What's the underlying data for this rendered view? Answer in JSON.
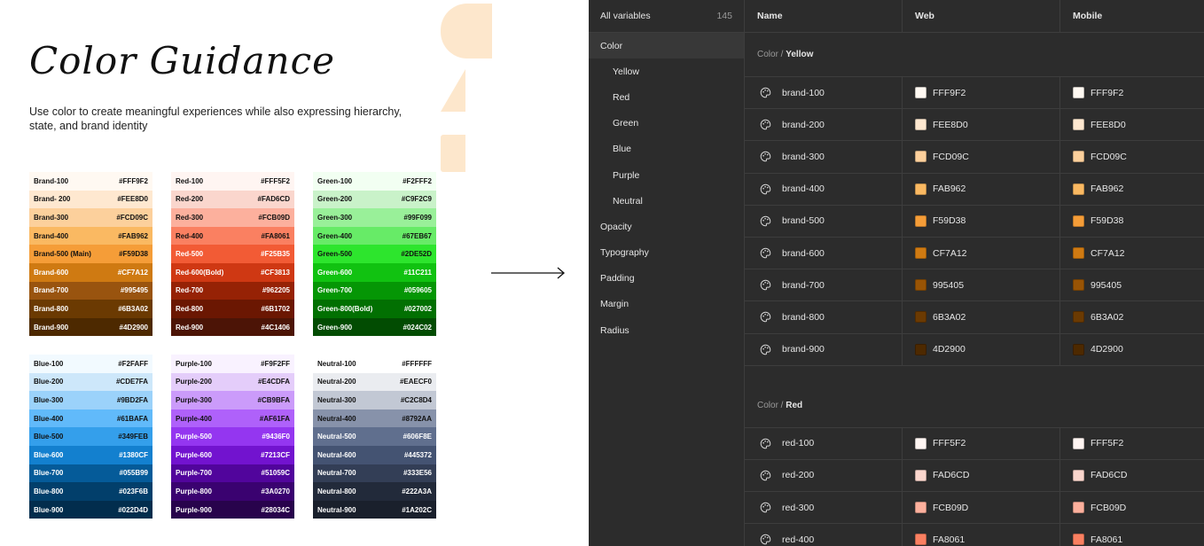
{
  "guidance": {
    "title": "Color Guidance",
    "subtitle": "Use color to create meaningful experiences while also expressing hierarchy, state, and brand identity",
    "palettes": [
      {
        "swatches": [
          {
            "label": "Brand-100",
            "hex": "#FFF9F2",
            "bg": "#FFF9F2",
            "fg": "#111111"
          },
          {
            "label": "Brand- 200",
            "hex": "#FEE8D0",
            "bg": "#FEE8D0",
            "fg": "#111111"
          },
          {
            "label": "Brand-300",
            "hex": "#FCD09C",
            "bg": "#FCD09C",
            "fg": "#111111"
          },
          {
            "label": "Brand-400",
            "hex": "#FAB962",
            "bg": "#FAB962",
            "fg": "#111111"
          },
          {
            "label": "Brand-500 (Main)",
            "hex": "#F59D38",
            "bg": "#F59D38",
            "fg": "#111111"
          },
          {
            "label": "Brand-600",
            "hex": "#CF7A12",
            "bg": "#CF7A12",
            "fg": "#ffffff"
          },
          {
            "label": "Brand-700",
            "hex": "#995495",
            "bg": "#99540F",
            "fg": "#ffffff"
          },
          {
            "label": "Brand-800",
            "hex": "#6B3A02",
            "bg": "#6B3A02",
            "fg": "#ffffff"
          },
          {
            "label": "Brand-900",
            "hex": "#4D2900",
            "bg": "#4D2900",
            "fg": "#ffffff"
          }
        ]
      },
      {
        "swatches": [
          {
            "label": "Red-100",
            "hex": "#FFF5F2",
            "bg": "#FFF5F2",
            "fg": "#111111"
          },
          {
            "label": "Red-200",
            "hex": "#FAD6CD",
            "bg": "#FAD6CD",
            "fg": "#111111"
          },
          {
            "label": "Red-300",
            "hex": "#FCB09D",
            "bg": "#FCB09D",
            "fg": "#111111"
          },
          {
            "label": "Red-400",
            "hex": "#FA8061",
            "bg": "#FA8061",
            "fg": "#111111"
          },
          {
            "label": "Red-500",
            "hex": "#F25B35",
            "bg": "#F25B35",
            "fg": "#ffffff"
          },
          {
            "label": "Red-600(Bold)",
            "hex": "#CF3813",
            "bg": "#CF3813",
            "fg": "#ffffff"
          },
          {
            "label": "Red-700",
            "hex": "#962205",
            "bg": "#962205",
            "fg": "#ffffff"
          },
          {
            "label": "Red-800",
            "hex": "#6B1702",
            "bg": "#6B1702",
            "fg": "#ffffff"
          },
          {
            "label": "Red-900",
            "hex": "#4C1406",
            "bg": "#4C1406",
            "fg": "#ffffff"
          }
        ]
      },
      {
        "swatches": [
          {
            "label": "Green-100",
            "hex": "#F2FFF2",
            "bg": "#F2FFF2",
            "fg": "#111111"
          },
          {
            "label": "Green-200",
            "hex": "#C9F2C9",
            "bg": "#C9F2C9",
            "fg": "#111111"
          },
          {
            "label": "Green-300",
            "hex": "#99F099",
            "bg": "#99F099",
            "fg": "#111111"
          },
          {
            "label": "Green-400",
            "hex": "#67EB67",
            "bg": "#67EB67",
            "fg": "#111111"
          },
          {
            "label": "Green-500",
            "hex": "#2DE52D",
            "bg": "#2DE52D",
            "fg": "#111111"
          },
          {
            "label": "Green-600",
            "hex": "#11C211",
            "bg": "#11C211",
            "fg": "#ffffff"
          },
          {
            "label": "Green-700",
            "hex": "#059605",
            "bg": "#059605",
            "fg": "#ffffff"
          },
          {
            "label": "Green-800(Bold)",
            "hex": "#027002",
            "bg": "#027002",
            "fg": "#ffffff"
          },
          {
            "label": "Green-900",
            "hex": "#024C02",
            "bg": "#024C02",
            "fg": "#ffffff"
          }
        ]
      },
      {
        "swatches": [
          {
            "label": "Blue-100",
            "hex": "#F2FAFF",
            "bg": "#F2FAFF",
            "fg": "#111111"
          },
          {
            "label": "Blue-200",
            "hex": "#CDE7FA",
            "bg": "#CDE7FA",
            "fg": "#111111"
          },
          {
            "label": "Blue-300",
            "hex": "#9BD2FA",
            "bg": "#9BD2FA",
            "fg": "#111111"
          },
          {
            "label": "Blue-400",
            "hex": "#61BAFA",
            "bg": "#61BAFA",
            "fg": "#111111"
          },
          {
            "label": "Blue-500",
            "hex": "#349FEB",
            "bg": "#349FEB",
            "fg": "#111111"
          },
          {
            "label": "Blue-600",
            "hex": "#1380CF",
            "bg": "#1380CF",
            "fg": "#ffffff"
          },
          {
            "label": "Blue-700",
            "hex": "#055B99",
            "bg": "#055B99",
            "fg": "#ffffff"
          },
          {
            "label": "Blue-800",
            "hex": "#023F6B",
            "bg": "#023F6B",
            "fg": "#ffffff"
          },
          {
            "label": "Blue-900",
            "hex": "#022D4D",
            "bg": "#022D4D",
            "fg": "#ffffff"
          }
        ]
      },
      {
        "swatches": [
          {
            "label": "Purple-100",
            "hex": "#F9F2FF",
            "bg": "#F9F2FF",
            "fg": "#111111"
          },
          {
            "label": "Purple-200",
            "hex": "#E4CDFA",
            "bg": "#E4CDFA",
            "fg": "#111111"
          },
          {
            "label": "Purple-300",
            "hex": "#CB9BFA",
            "bg": "#CB9BFA",
            "fg": "#111111"
          },
          {
            "label": "Purple-400",
            "hex": "#AF61FA",
            "bg": "#AF61FA",
            "fg": "#111111"
          },
          {
            "label": "Purple-500",
            "hex": "#9436F0",
            "bg": "#9436F0",
            "fg": "#ffffff"
          },
          {
            "label": "Purple-600",
            "hex": "#7213CF",
            "bg": "#7213CF",
            "fg": "#ffffff"
          },
          {
            "label": "Purple-700",
            "hex": "#51059C",
            "bg": "#51059C",
            "fg": "#ffffff"
          },
          {
            "label": "Purple-800",
            "hex": "#3A0270",
            "bg": "#3A0270",
            "fg": "#ffffff"
          },
          {
            "label": "Purple-900",
            "hex": "#28034C",
            "bg": "#28034C",
            "fg": "#ffffff"
          }
        ]
      },
      {
        "swatches": [
          {
            "label": "Neutral-100",
            "hex": "#FFFFFF",
            "bg": "#FFFFFF",
            "fg": "#111111"
          },
          {
            "label": "Neutral-200",
            "hex": "#EAECF0",
            "bg": "#EAECF0",
            "fg": "#111111"
          },
          {
            "label": "Neutral-300",
            "hex": "#C2C8D4",
            "bg": "#C2C8D4",
            "fg": "#111111"
          },
          {
            "label": "Neutral-400",
            "hex": "#8792AA",
            "bg": "#8792AA",
            "fg": "#111111"
          },
          {
            "label": "Neutral-500",
            "hex": "#606F8E",
            "bg": "#606F8E",
            "fg": "#ffffff"
          },
          {
            "label": "Neutral-600",
            "hex": "#445372",
            "bg": "#445372",
            "fg": "#ffffff"
          },
          {
            "label": "Neutral-700",
            "hex": "#333E56",
            "bg": "#333E56",
            "fg": "#ffffff"
          },
          {
            "label": "Neutral-800",
            "hex": "#222A3A",
            "bg": "#222A3A",
            "fg": "#ffffff"
          },
          {
            "label": "Neutral-900",
            "hex": "#1A202C",
            "bg": "#1A202C",
            "fg": "#ffffff"
          }
        ]
      }
    ]
  },
  "panel": {
    "header": {
      "label": "All variables",
      "count": "145"
    },
    "sidebar": [
      {
        "label": "Color",
        "sub": false,
        "active": true
      },
      {
        "label": "Yellow",
        "sub": true,
        "active": false
      },
      {
        "label": "Red",
        "sub": true,
        "active": false
      },
      {
        "label": "Green",
        "sub": true,
        "active": false
      },
      {
        "label": "Blue",
        "sub": true,
        "active": false
      },
      {
        "label": "Purple",
        "sub": true,
        "active": false
      },
      {
        "label": "Neutral",
        "sub": true,
        "active": false
      },
      {
        "label": "Opacity",
        "sub": false,
        "active": false
      },
      {
        "label": "Typography",
        "sub": false,
        "active": false
      },
      {
        "label": "Padding",
        "sub": false,
        "active": false
      },
      {
        "label": "Margin",
        "sub": false,
        "active": false
      },
      {
        "label": "Radius",
        "sub": false,
        "active": false
      }
    ],
    "columns": {
      "name": "Name",
      "web": "Web",
      "mobile": "Mobile"
    },
    "groups": [
      {
        "prefix": "Color / ",
        "name": "Yellow",
        "rows": [
          {
            "name": "brand-100",
            "web": "FFF9F2",
            "mobile": "FFF9F2",
            "color": "#FFF9F2"
          },
          {
            "name": "brand-200",
            "web": "FEE8D0",
            "mobile": "FEE8D0",
            "color": "#FEE8D0"
          },
          {
            "name": "brand-300",
            "web": "FCD09C",
            "mobile": "FCD09C",
            "color": "#FCD09C"
          },
          {
            "name": "brand-400",
            "web": "FAB962",
            "mobile": "FAB962",
            "color": "#FAB962"
          },
          {
            "name": "brand-500",
            "web": "F59D38",
            "mobile": "F59D38",
            "color": "#F59D38"
          },
          {
            "name": "brand-600",
            "web": "CF7A12",
            "mobile": "CF7A12",
            "color": "#CF7A12"
          },
          {
            "name": "brand-700",
            "web": "995405",
            "mobile": "995405",
            "color": "#995405"
          },
          {
            "name": "brand-800",
            "web": "6B3A02",
            "mobile": "6B3A02",
            "color": "#6B3A02"
          },
          {
            "name": "brand-900",
            "web": "4D2900",
            "mobile": "4D2900",
            "color": "#4D2900"
          }
        ]
      },
      {
        "prefix": "Color / ",
        "name": "Red",
        "rows": [
          {
            "name": "red-100",
            "web": "FFF5F2",
            "mobile": "FFF5F2",
            "color": "#FFF5F2"
          },
          {
            "name": "red-200",
            "web": "FAD6CD",
            "mobile": "FAD6CD",
            "color": "#FAD6CD"
          },
          {
            "name": "red-300",
            "web": "FCB09D",
            "mobile": "FCB09D",
            "color": "#FCB09D"
          },
          {
            "name": "red-400",
            "web": "FA8061",
            "mobile": "FA8061",
            "color": "#FA8061"
          }
        ]
      }
    ]
  }
}
